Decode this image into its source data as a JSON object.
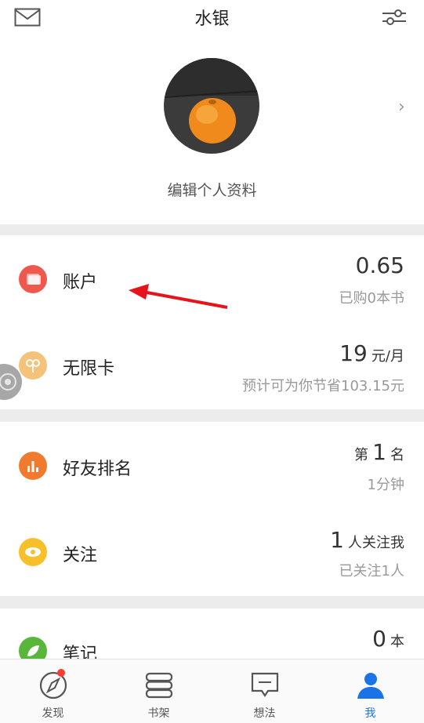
{
  "header": {
    "title": "水银",
    "left_icon": "mail-icon",
    "right_icon": "filter-settings-icon"
  },
  "profile": {
    "edit_label": "编辑个人资料",
    "chevron": "›"
  },
  "rows": {
    "account": {
      "label": "账户",
      "value": "0.65",
      "sub": "已购0本书",
      "icon_color": "#f0584d"
    },
    "unlimited_card": {
      "label": "无限卡",
      "value_num": "19",
      "value_unit": "元/月",
      "sub": "预计可为你节省103.15元",
      "icon_color": "#f5c27a"
    },
    "friend_rank": {
      "label": "好友排名",
      "prefix": "第",
      "value_num": "1",
      "suffix": "名",
      "sub": "1分钟",
      "icon_color": "#f07a2e"
    },
    "follow": {
      "label": "关注",
      "value_num": "1",
      "suffix": "人关注我",
      "sub": "已关注1人",
      "icon_color": "#f7c02a"
    },
    "notes": {
      "label": "笔记",
      "value_num": "0",
      "suffix": "本",
      "icon_color": "#5ab53b"
    }
  },
  "tabs": [
    {
      "label": "发现",
      "icon": "compass-icon",
      "active": false
    },
    {
      "label": "书架",
      "icon": "bookshelf-icon",
      "active": false
    },
    {
      "label": "想法",
      "icon": "thoughts-icon",
      "active": false
    },
    {
      "label": "我",
      "icon": "person-icon",
      "active": true
    }
  ],
  "colors": {
    "accent": "#1a74e8",
    "annotation_arrow": "#e8131a"
  }
}
